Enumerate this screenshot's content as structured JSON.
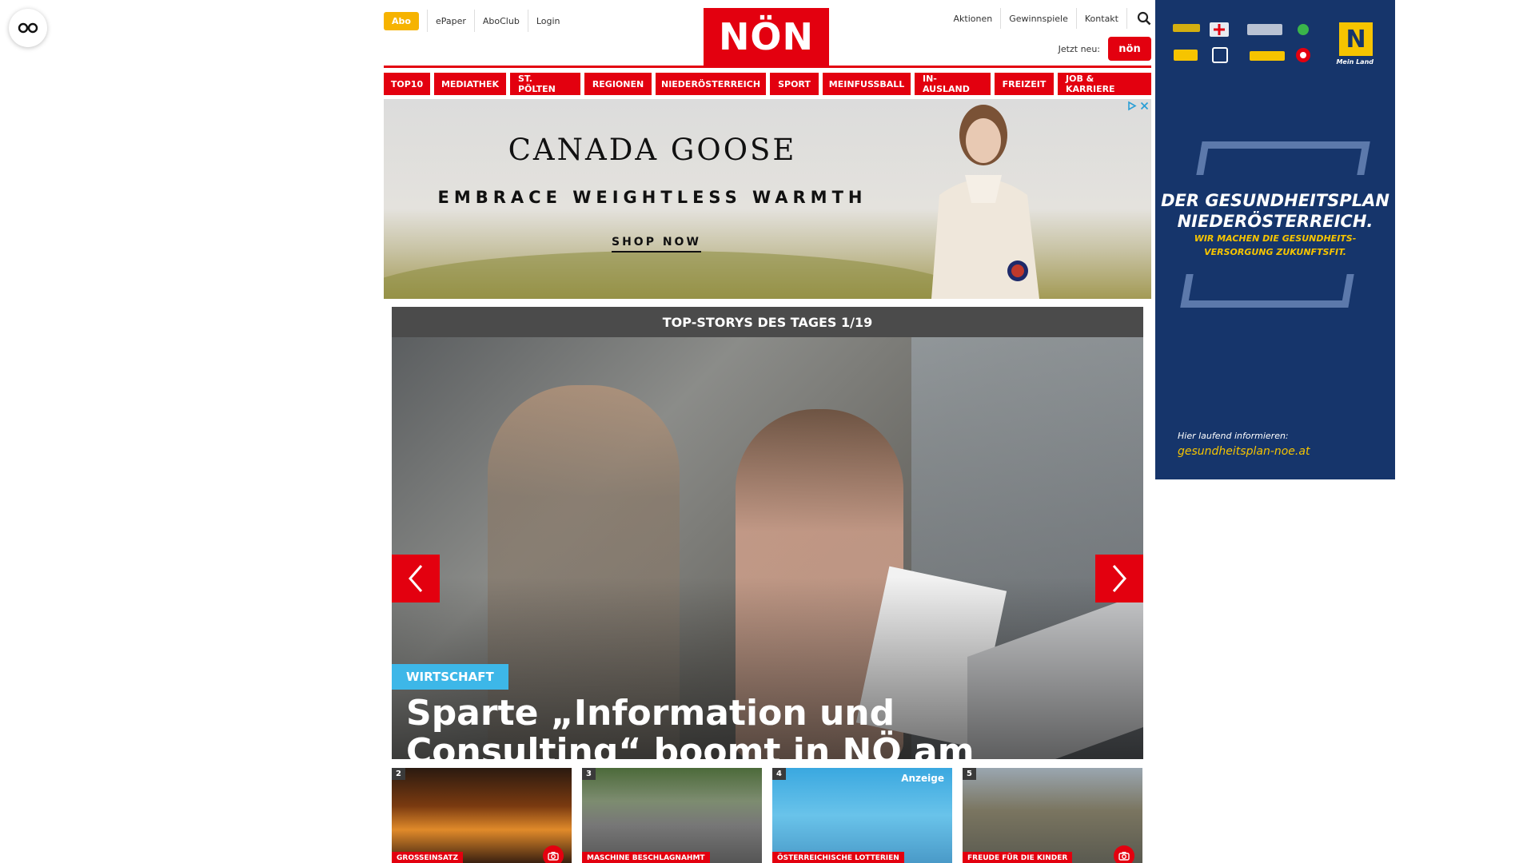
{
  "header": {
    "abo_label": "Abo",
    "top_links": [
      "ePaper",
      "AboClub",
      "Login"
    ],
    "logo_text": "NÖN",
    "right_links": [
      "Aktionen",
      "Gewinnspiele",
      "Kontakt"
    ],
    "jetzt_label": "Jetzt neu:",
    "jetzt_logo_text": "nön"
  },
  "nav": {
    "items": [
      "TOP10",
      "MEDIATHEK",
      "ST. PÖLTEN",
      "REGIONEN",
      "NIEDERÖSTERREICH",
      "SPORT",
      "MEINFUSSBALL",
      "IN-AUSLAND",
      "FREIZEIT",
      "JOB & KARRIERE"
    ]
  },
  "ad_banner": {
    "brand": "CANADA GOOSE",
    "tagline": "EMBRACE WEIGHTLESS WARMTH",
    "cta": "SHOP NOW"
  },
  "side_ad": {
    "headline_line1": "DER GESUNDHEITSPLAN",
    "headline_line2": "NIEDERÖSTERREICH.",
    "sub_line1": "WIR MACHEN DIE GESUNDHEITS-",
    "sub_line2": "VERSORGUNG ZUKUNFTSFIT.",
    "note": "Hier laufend informieren:",
    "url": "gesundheitsplan-noe.at",
    "logo_n": "N",
    "logo_caption": "Mein Land"
  },
  "slider": {
    "heading": "TOP-STORYS DES TAGES 1/19",
    "category": "WIRTSCHAFT",
    "title": "Sparte „Information und Consulting“ boomt in NÖ am stärksten"
  },
  "teasers": [
    {
      "num": "2",
      "category": "GROSSEINSATZ",
      "has_camera": true
    },
    {
      "num": "3",
      "category": "MASCHINE BESCHLAGNAHMT",
      "has_camera": false
    },
    {
      "num": "4",
      "category": "ÖSTERREICHISCHE LOTTERIEN",
      "badge": "Anzeige"
    },
    {
      "num": "5",
      "category": "FREUDE FÜR DIE KINDER",
      "has_camera": true
    }
  ],
  "colors": {
    "brand_red": "#e3000f",
    "abo_yellow": "#f6b300",
    "side_ad_blue": "#16356b",
    "side_ad_yellow": "#f6c400",
    "category_blue": "#3db7e8"
  }
}
